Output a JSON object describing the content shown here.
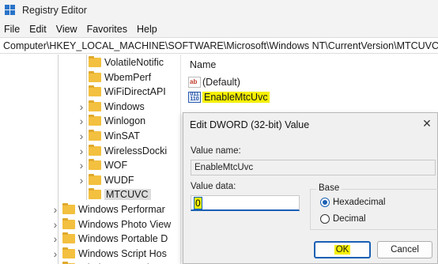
{
  "window": {
    "title": "Registry Editor"
  },
  "menu": [
    "File",
    "Edit",
    "View",
    "Favorites",
    "Help"
  ],
  "address": "Computer\\HKEY_LOCAL_MACHINE\\SOFTWARE\\Microsoft\\Windows NT\\CurrentVersion\\MTCUVC",
  "tree": {
    "items": [
      {
        "label": "VolatileNotific",
        "expandable": false
      },
      {
        "label": "WbemPerf",
        "expandable": false
      },
      {
        "label": "WiFiDirectAPI",
        "expandable": false
      },
      {
        "label": "Windows",
        "expandable": true
      },
      {
        "label": "Winlogon",
        "expandable": true
      },
      {
        "label": "WinSAT",
        "expandable": true
      },
      {
        "label": "WirelessDocki",
        "expandable": true
      },
      {
        "label": "WOF",
        "expandable": true
      },
      {
        "label": "WUDF",
        "expandable": true
      },
      {
        "label": "MTCUVC",
        "expandable": false,
        "selected": true
      },
      {
        "label": "Windows Performar",
        "expandable": true
      },
      {
        "label": "Windows Photo View",
        "expandable": true
      },
      {
        "label": "Windows Portable D",
        "expandable": true
      },
      {
        "label": "Windows Script Hos",
        "expandable": true
      },
      {
        "label": "Windows Search",
        "expandable": true
      }
    ]
  },
  "list": {
    "column_name": "Name",
    "values": [
      {
        "name": "(Default)",
        "icon": "string-value-icon"
      },
      {
        "name": "EnableMtcUvc",
        "icon": "dword-value-icon",
        "highlighted": true
      }
    ]
  },
  "dialog": {
    "title": "Edit DWORD (32-bit) Value",
    "close_glyph": "✕",
    "value_name_label": "Value name:",
    "value_name": "EnableMtcUvc",
    "value_data_label": "Value data:",
    "value_data": "0",
    "base_label": "Base",
    "base_options": [
      {
        "label": "Hexadecimal",
        "checked": true
      },
      {
        "label": "Decimal",
        "checked": false
      }
    ],
    "ok_label": "OK",
    "cancel_label": "Cancel"
  },
  "colors": {
    "highlight": "#f5f000",
    "accent": "#1a5fb4",
    "folder": "#f3c03f"
  }
}
